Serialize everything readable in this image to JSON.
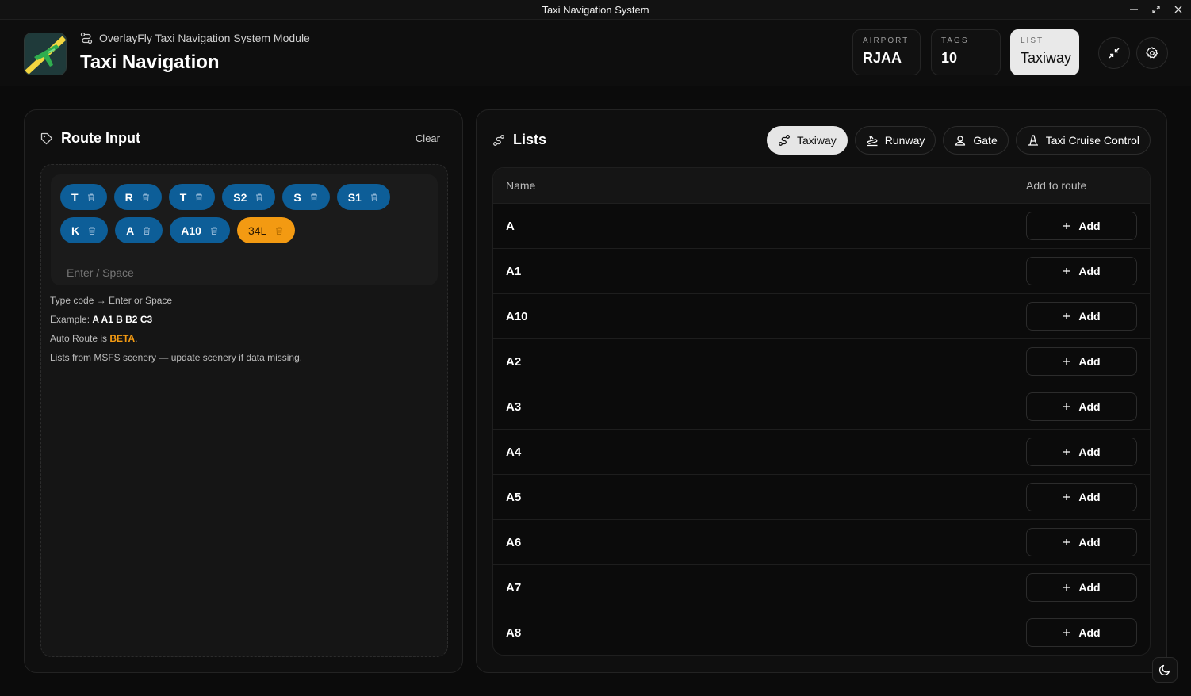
{
  "window": {
    "title": "Taxi Navigation System"
  },
  "header": {
    "subtitle": "OverlayFly Taxi Navigation System Module",
    "title": "Taxi Navigation",
    "stats": [
      {
        "label": "AIRPORT",
        "value": "RJAA"
      },
      {
        "label": "TAGS",
        "value": "10"
      },
      {
        "label": "LIST",
        "value": "Taxiway"
      }
    ]
  },
  "route_input": {
    "title": "Route Input",
    "clear_label": "Clear",
    "chips": [
      {
        "label": "T"
      },
      {
        "label": "R"
      },
      {
        "label": "T"
      },
      {
        "label": "S2"
      },
      {
        "label": "S"
      },
      {
        "label": "S1"
      },
      {
        "label": "K"
      },
      {
        "label": "A"
      },
      {
        "label": "A10"
      },
      {
        "label": "34L"
      }
    ],
    "placeholder": "Enter / Space",
    "help": {
      "line1": "Type code → Enter or Space",
      "example_prefix": "Example: ",
      "example_value": "A A1 B B2 C3",
      "auto_prefix": "Auto Route is ",
      "auto_badge": "BETA",
      "auto_suffix": ".",
      "line4": "Lists from MSFS scenery — update scenery if data missing."
    }
  },
  "lists": {
    "title": "Lists",
    "tabs": [
      {
        "label": "Taxiway",
        "active": true
      },
      {
        "label": "Runway",
        "active": false
      },
      {
        "label": "Gate",
        "active": false
      },
      {
        "label": "Taxi Cruise Control",
        "active": false
      }
    ],
    "columns": {
      "name": "Name",
      "action": "Add to route"
    },
    "add_label": "Add",
    "rows": [
      "A",
      "A1",
      "A10",
      "A2",
      "A3",
      "A4",
      "A5",
      "A6",
      "A7",
      "A8"
    ]
  },
  "colors": {
    "chip_blue": "#0d5e98",
    "chip_orange": "#f39a12",
    "beta": "#f39a12"
  }
}
